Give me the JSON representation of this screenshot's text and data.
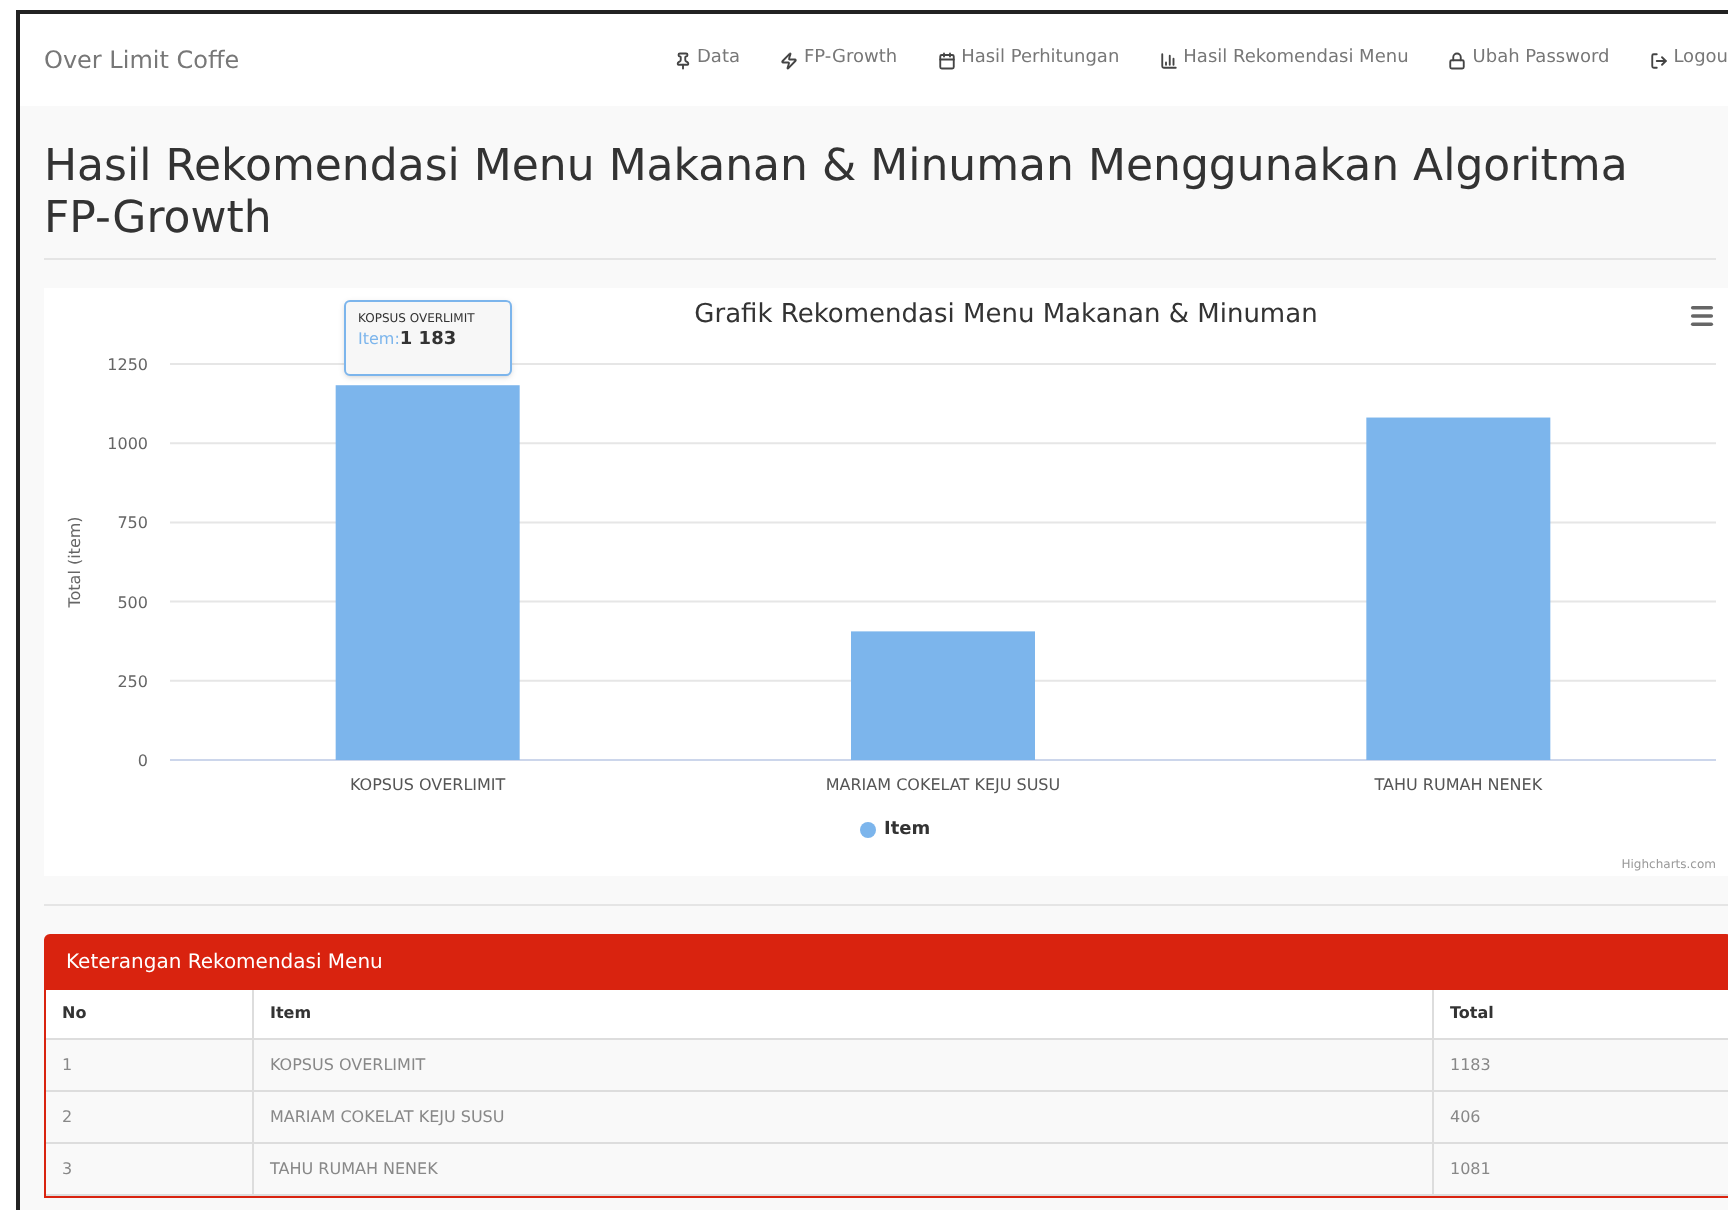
{
  "navbar": {
    "brand": "Over Limit Coffe",
    "links": [
      {
        "label": "Data"
      },
      {
        "label": "FP-Growth"
      },
      {
        "label": "Hasil Perhitungan"
      },
      {
        "label": "Hasil Rekomendasi Menu"
      },
      {
        "label": "Ubah Password"
      },
      {
        "label": "Logou"
      }
    ]
  },
  "page_title": "Hasil Rekomendasi Menu Makanan & Minuman Menggunakan Algoritma FP-Growth",
  "chart": {
    "tooltip": {
      "title": "KOPSUS OVERLIMIT",
      "label": "Item:",
      "value": "1 183"
    },
    "credits": "Highcharts.com",
    "chart_data": {
      "type": "bar",
      "title": "Grafik Rekomendasi Menu Makanan & Minuman",
      "ylabel": "Total (item)",
      "categories": [
        "KOPSUS OVERLIMIT",
        "MARIAM COKELAT KEJU SUSU",
        "TAHU RUMAH NENEK"
      ],
      "series": [
        {
          "name": "Item",
          "color": "#7cb5ec",
          "values": [
            1183,
            406,
            1081
          ]
        }
      ],
      "ylim": [
        0,
        1250
      ],
      "grid": true,
      "yticks": [
        0,
        250,
        500,
        750,
        1000,
        1250
      ]
    }
  },
  "table": {
    "title": "Keterangan Rekomendasi Menu",
    "columns": [
      "No",
      "Item",
      "Total"
    ],
    "rows": [
      [
        "1",
        "KOPSUS OVERLIMIT",
        "1183"
      ],
      [
        "2",
        "MARIAM COKELAT KEJU SUSU",
        "406"
      ],
      [
        "3",
        "TAHU RUMAH NENEK",
        "1081"
      ]
    ]
  }
}
